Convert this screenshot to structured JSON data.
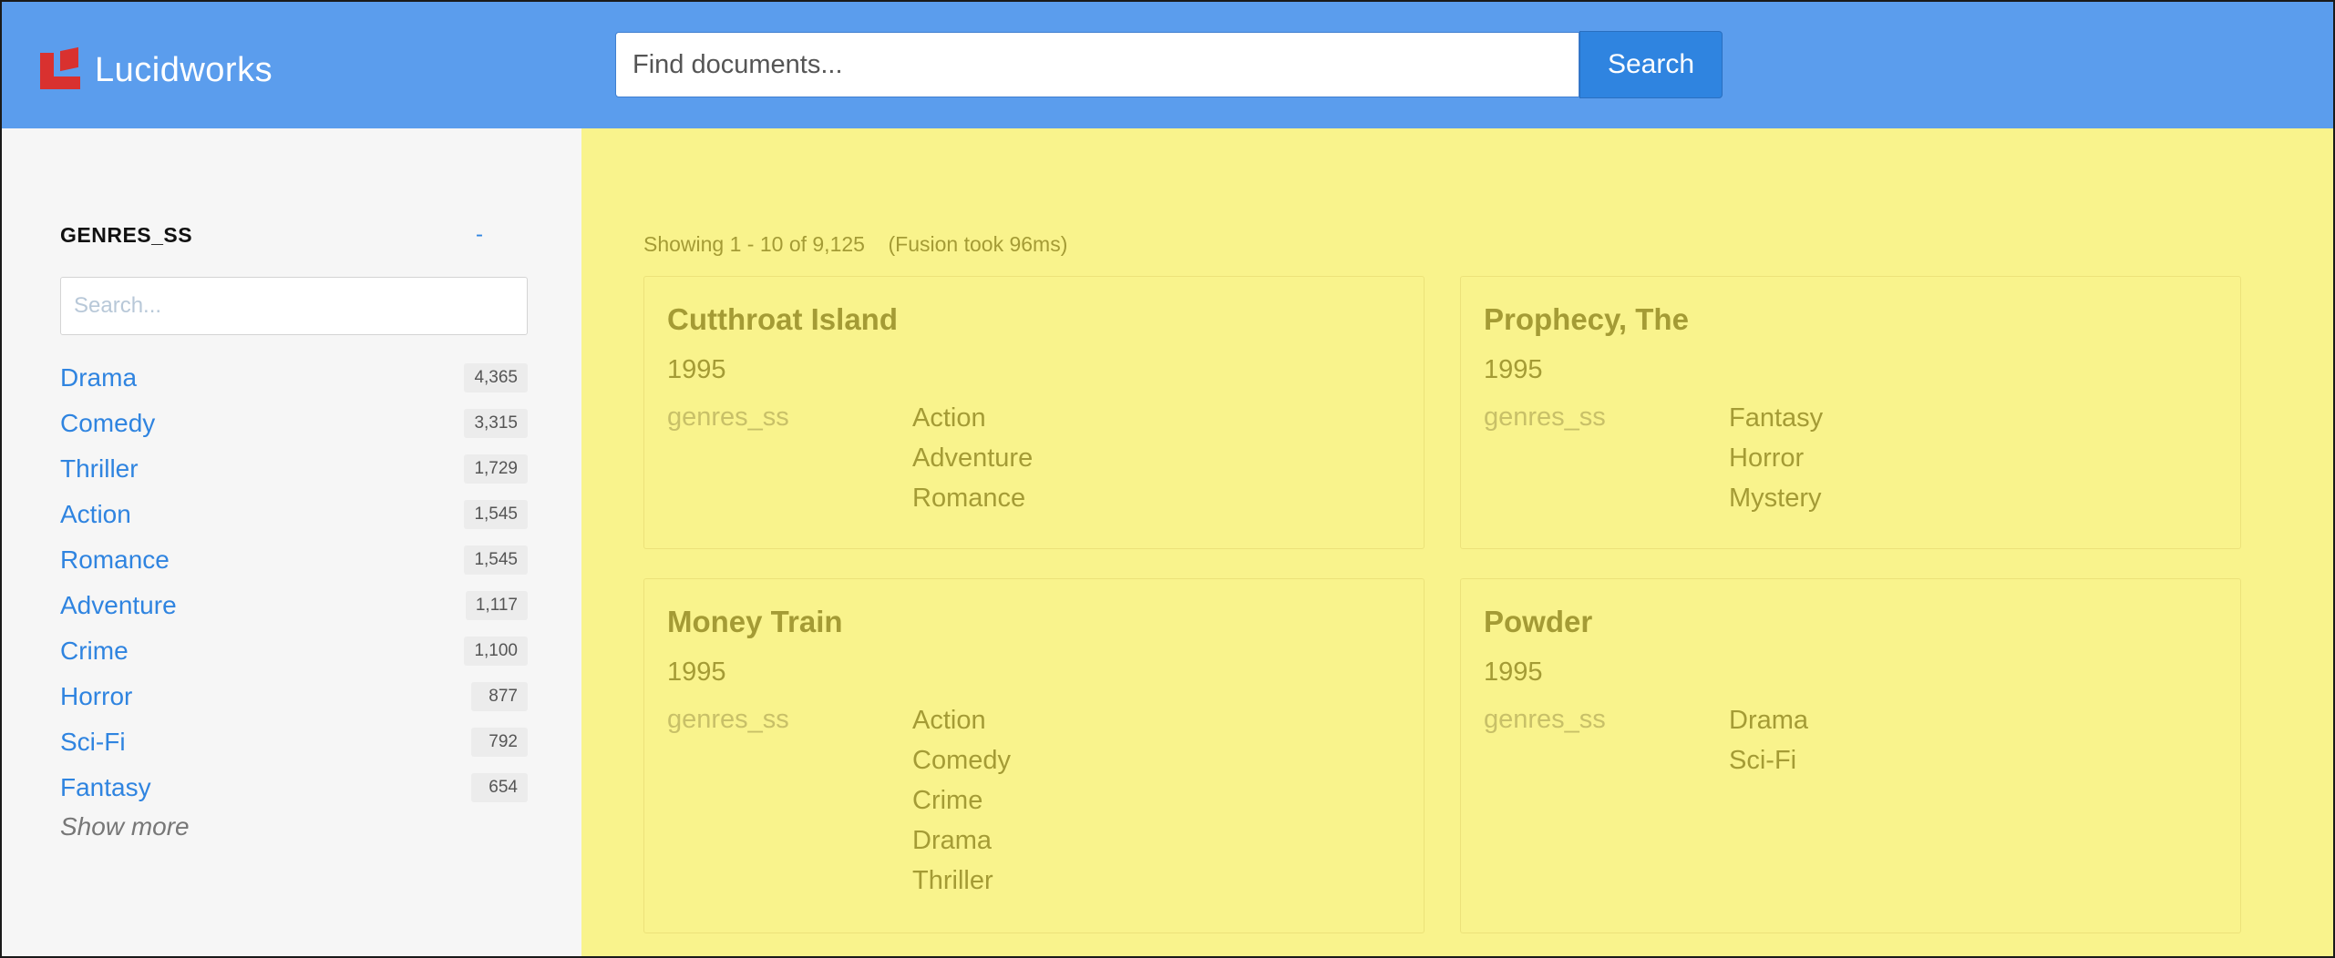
{
  "header": {
    "brand": "Lucidworks",
    "search_placeholder": "Find documents...",
    "search_button": "Search",
    "colors": {
      "header_bg": "#5b9ded",
      "button_bg": "#2f84e0",
      "logo_red": "#d9312f"
    }
  },
  "sidebar": {
    "facet_title": "GENRES_SS",
    "collapse_label": "-",
    "search_placeholder": "Search...",
    "facets": [
      {
        "label": "Drama",
        "count": "4,365"
      },
      {
        "label": "Comedy",
        "count": "3,315"
      },
      {
        "label": "Thriller",
        "count": "1,729"
      },
      {
        "label": "Action",
        "count": "1,545"
      },
      {
        "label": "Romance",
        "count": "1,545"
      },
      {
        "label": "Adventure",
        "count": "1,117"
      },
      {
        "label": "Crime",
        "count": "1,100"
      },
      {
        "label": "Horror",
        "count": "877"
      },
      {
        "label": "Sci-Fi",
        "count": "792"
      },
      {
        "label": "Fantasy",
        "count": "654"
      }
    ],
    "show_more": "Show more"
  },
  "main": {
    "showing": "Showing 1 - 10 of 9,125",
    "timing": "(Fusion took 96ms)",
    "results_bg": "#f9f38c",
    "results": [
      {
        "title": "Cutthroat Island",
        "year": "1995",
        "field": "genres_ss",
        "genres": [
          "Action",
          "Adventure",
          "Romance"
        ]
      },
      {
        "title": "Prophecy, The",
        "year": "1995",
        "field": "genres_ss",
        "genres": [
          "Fantasy",
          "Horror",
          "Mystery"
        ]
      },
      {
        "title": "Money Train",
        "year": "1995",
        "field": "genres_ss",
        "genres": [
          "Action",
          "Comedy",
          "Crime",
          "Drama",
          "Thriller"
        ]
      },
      {
        "title": "Powder",
        "year": "1995",
        "field": "genres_ss",
        "genres": [
          "Drama",
          "Sci-Fi"
        ]
      }
    ]
  }
}
